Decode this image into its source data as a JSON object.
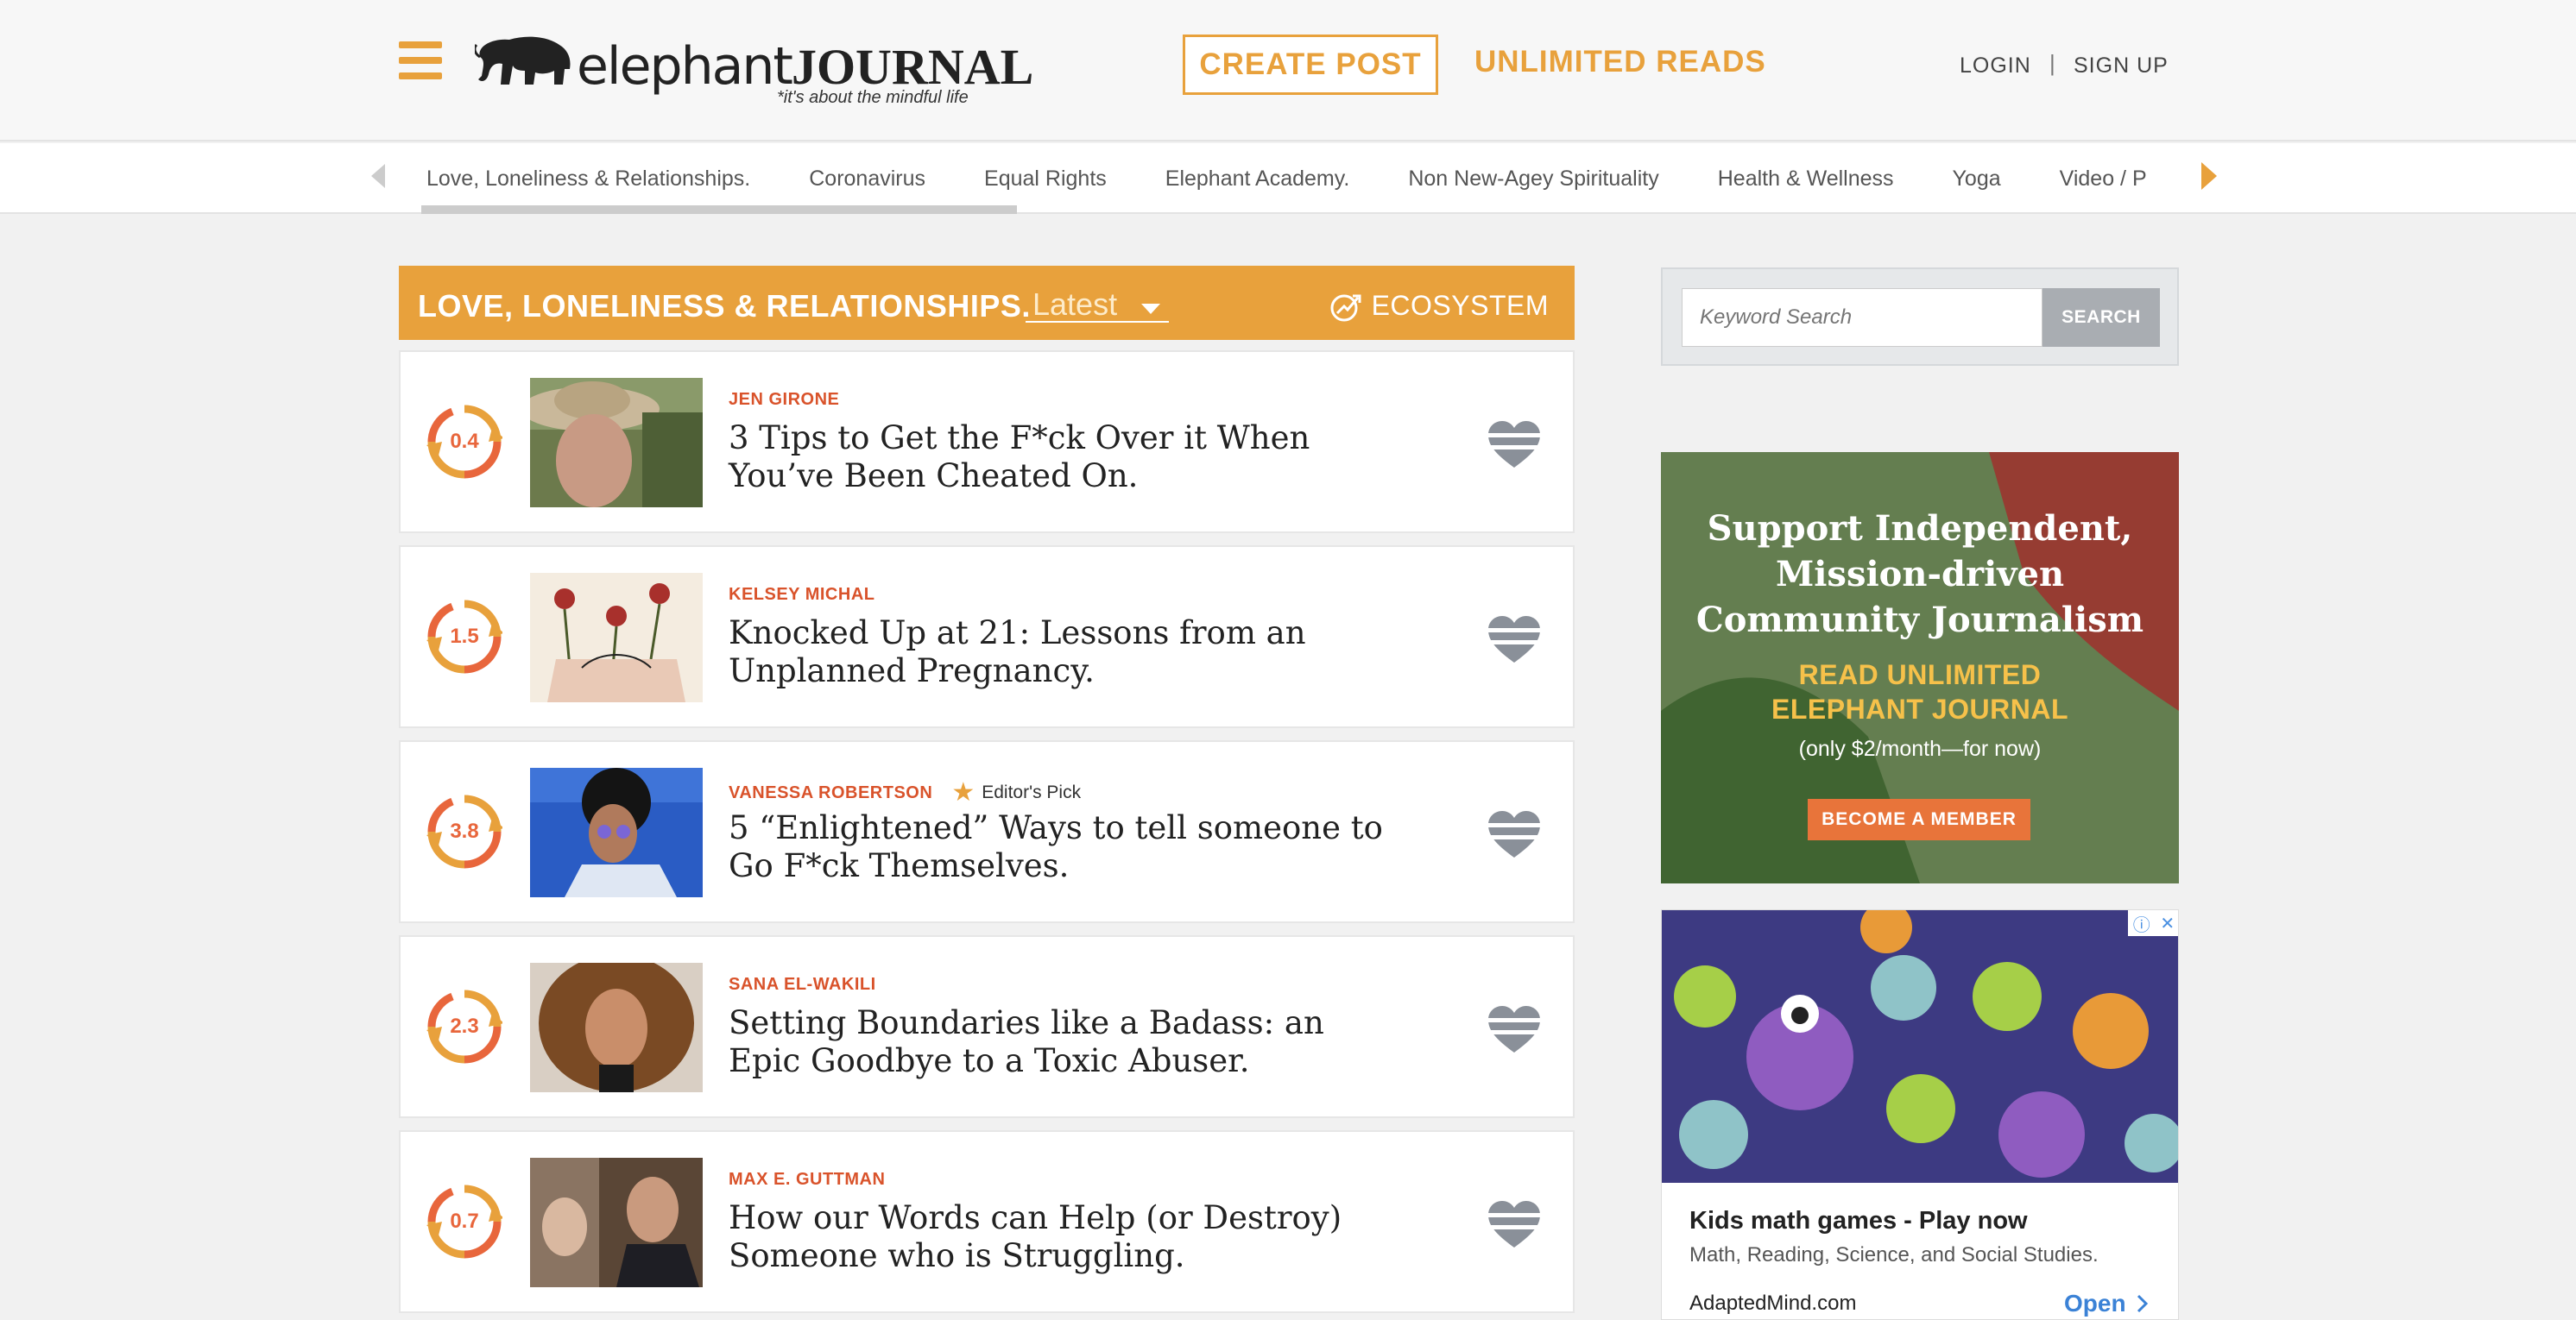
{
  "header": {
    "logo_word": "elephant",
    "logo_word_bold": "JOURNAL",
    "logo_tagline": "*it's about the mindful life",
    "create_post": "CREATE POST",
    "unlimited_reads": "UNLIMITED READS",
    "login": "LOGIN",
    "separator": "|",
    "signup": "SIGN UP"
  },
  "categories": [
    "Love, Loneliness & Relationships.",
    "Coronavirus",
    "Equal Rights",
    "Elephant Academy.",
    "Non New-Agey Spirituality",
    "Health & Wellness",
    "Yoga",
    "Video / P"
  ],
  "feed": {
    "title": "LOVE, LONELINESS & RELATIONSHIPS.",
    "sort_label": "Latest",
    "ecosystem_label": "ECOSYSTEM"
  },
  "articles": [
    {
      "score": "0.4",
      "author": "JEN GIRONE",
      "title": "3 Tips to Get the F*ck Over it When You’ve Been Cheated On.",
      "editors_pick": ""
    },
    {
      "score": "1.5",
      "author": "KELSEY MICHAL",
      "title": "Knocked Up at 21: Lessons from an Unplanned Pregnancy.",
      "editors_pick": ""
    },
    {
      "score": "3.8",
      "author": "VANESSA ROBERTSON",
      "title": "5 “Enlightened” Ways to tell someone to Go F*ck Themselves.",
      "editors_pick": "Editor's Pick"
    },
    {
      "score": "2.3",
      "author": "SANA EL-WAKILI",
      "title": "Setting Boundaries like a Badass: an Epic Goodbye to a Toxic Abuser.",
      "editors_pick": ""
    },
    {
      "score": "0.7",
      "author": "MAX E. GUTTMAN",
      "title": "How our Words can Help (or Destroy) Someone who is Struggling.",
      "editors_pick": ""
    }
  ],
  "sidebar": {
    "search_placeholder": "Keyword Search",
    "search_button": "SEARCH",
    "promo": {
      "line1": "Support Independent,",
      "line2": "Mission-driven",
      "line3": "Community Journalism",
      "read1": "READ UNLIMITED",
      "read2": "ELEPHANT JOURNAL",
      "note": "(only $2/month—for now)",
      "button": "BECOME A MEMBER"
    },
    "ad": {
      "title": "Kids math games - Play now",
      "description": "Math, Reading, Science, and Social Studies.",
      "domain": "AdaptedMind.com",
      "cta": "Open"
    }
  },
  "colors": {
    "brand_orange": "#e8a13c",
    "author_red": "#d9532b",
    "score_red": "#e8663c",
    "page_bg": "#f1f1f1"
  }
}
